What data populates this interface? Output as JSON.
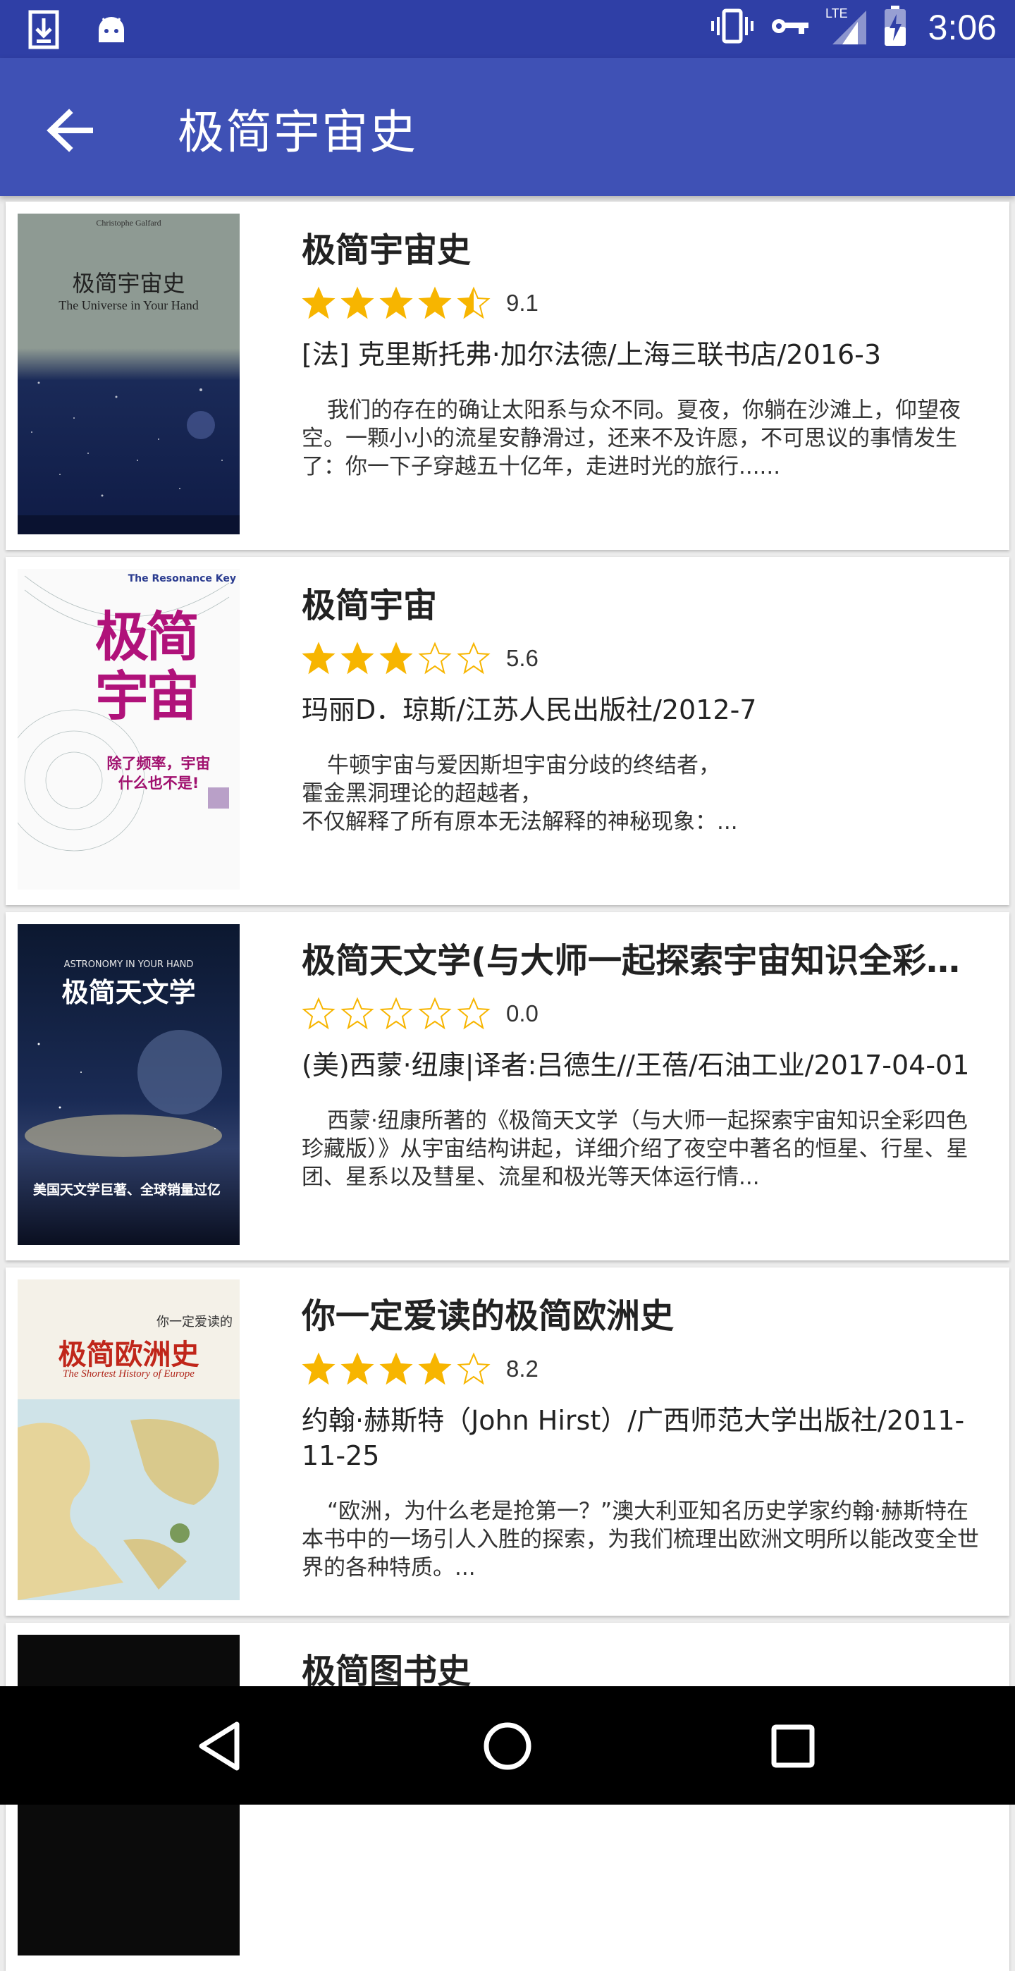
{
  "status_bar": {
    "time": "3:06",
    "network": "LTE",
    "icons": [
      "download-icon",
      "android-icon",
      "vibrate-icon",
      "key-icon",
      "signal-icon",
      "battery-charging-icon"
    ]
  },
  "app_bar": {
    "title": "极简宇宙史",
    "back_icon": "arrow-back-icon"
  },
  "books": [
    {
      "title": "极简宇宙史",
      "rating": 9.1,
      "score": "9.1",
      "stars": 4.5,
      "author": "[法] 克里斯托弗·加尔法德/上海三联书店/2016-3",
      "desc": "我们的存在的确让太阳系与众不同。夏夜，你躺在沙滩上，仰望夜空。一颗小小的流星安静滑过，还来不及许愿，不可思议的事情发生了：你一下子穿越五十亿年，走进时光的旅行......",
      "cover": {
        "title": "极简宇宙史",
        "subtitle": "The Universe in Your Hand",
        "author_line": "Christophe Galfard"
      }
    },
    {
      "title": "极简宇宙",
      "rating": 5.6,
      "score": "5.6",
      "stars": 3,
      "author": "玛丽D．琼斯/江苏人民出版社/2012-7",
      "desc": "牛顿宇宙与爱因斯坦宇宙分歧的终结者，\n霍金黑洞理论的超越者，\n不仅解释了所有原本无法解释的神秘现象：...",
      "cover": {
        "title": "极简宇宙",
        "subtitle": "The Resonance Key",
        "tagline": "除了频率，宇宙什么也不是!"
      }
    },
    {
      "title": "极简天文学(与大师一起探索宇宙知识全彩四色珍藏版)",
      "rating": 0.0,
      "score": "0.0",
      "stars": 0,
      "author": "(美)西蒙·纽康|译者:吕德生//王蓓/石油工业/2017-04-01",
      "desc": "西蒙·纽康所著的《极简天文学（与大师一起探索宇宙知识全彩四色珍藏版）》从宇宙结构讲起，详细介绍了夜空中著名的恒星、行星、星团、星系以及彗星、流星和极光等天体运行情...",
      "cover": {
        "title": "极简天文学",
        "subtitle": "ASTRONOMY IN YOUR HAND",
        "tagline": "美国天文学巨著、全球销量过亿"
      }
    },
    {
      "title": "你一定爱读的极简欧洲史",
      "rating": 8.2,
      "score": "8.2",
      "stars": 4,
      "author": "约翰·赫斯特（John Hirst）/广西师范大学出版社/2011-11-25",
      "desc": "“欧洲，为什么老是抢第一？”澳大利亚知名历史学家约翰·赫斯特在本书中的一场引人入胜的探索，为我们梳理出欧洲文明所以能改变全世界的各种特质。...",
      "cover": {
        "title": "极简欧洲史",
        "subtitle": "The Shortest History of Europe",
        "tagline": "你一定爱读的"
      }
    },
    {
      "title": "极简图书史",
      "rating": null,
      "score": "",
      "stars": 0,
      "author": "",
      "desc": "",
      "cover": {
        "title": "",
        "subtitle": ""
      }
    }
  ],
  "nav_bar": {
    "back": "nav-back-icon",
    "home": "nav-home-icon",
    "recents": "nav-recents-icon"
  }
}
